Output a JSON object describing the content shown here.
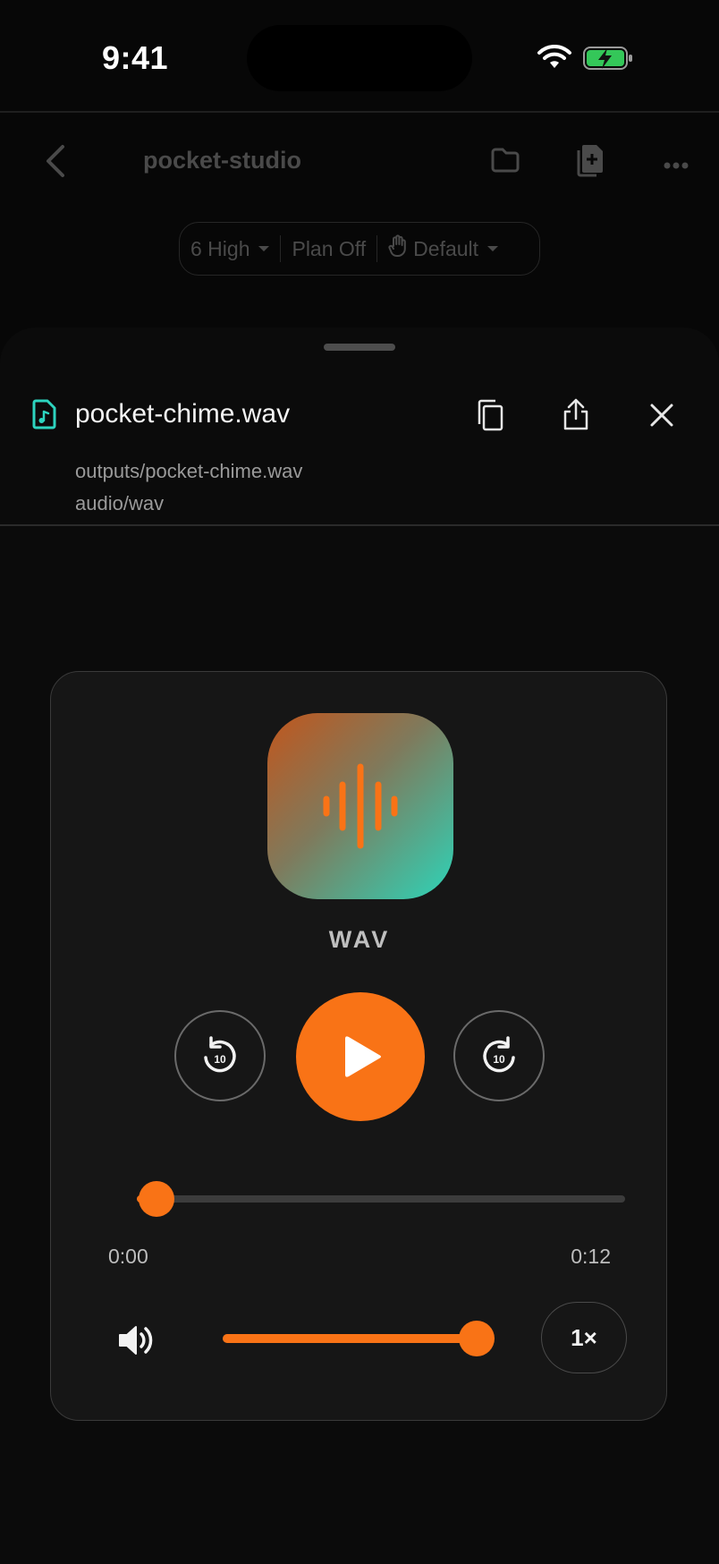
{
  "status_bar": {
    "time": "9:41"
  },
  "header": {
    "title": "pocket-studio",
    "pills": {
      "effort": "6 High",
      "plan": "Plan Off",
      "permission": "Default"
    }
  },
  "file": {
    "name": "pocket-chime.wav",
    "path": "outputs/pocket-chime.wav",
    "mime": "audio/wav"
  },
  "player": {
    "format_label": "WAV",
    "current_time": "0:00",
    "duration": "0:12",
    "skip_back_seconds": "10",
    "skip_forward_seconds": "10",
    "progress_fraction": 0.04,
    "volume_fraction": 1.0,
    "speed": "1×",
    "accent_color": "#f97316"
  },
  "icons": {
    "status": [
      "wifi-icon",
      "battery-charging-icon"
    ],
    "header": [
      "back-chevron-icon",
      "folder-icon",
      "add-document-icon",
      "more-icon",
      "hand-icon"
    ],
    "sheet": [
      "audio-file-icon",
      "copy-icon",
      "share-icon",
      "close-icon"
    ],
    "player": [
      "waveform-icon",
      "replay-10-icon",
      "play-icon",
      "forward-10-icon",
      "volume-icon"
    ]
  }
}
